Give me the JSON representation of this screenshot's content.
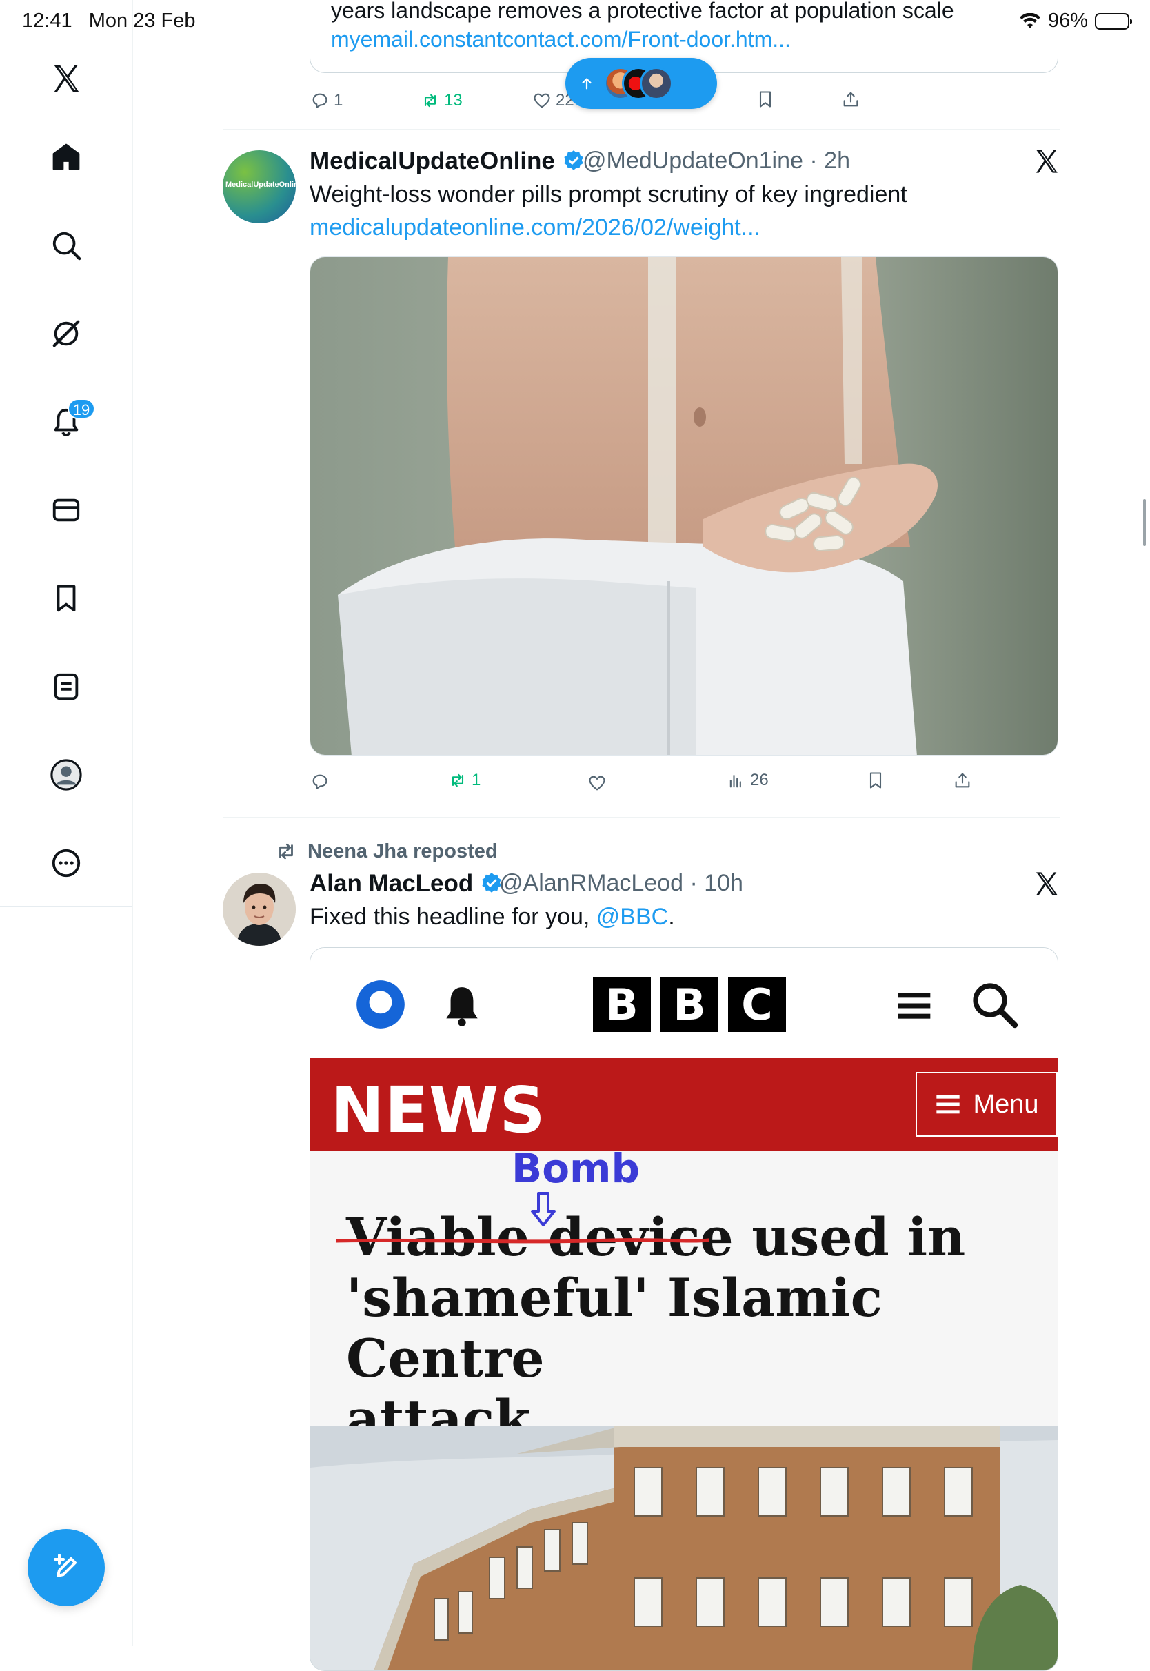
{
  "status_bar": {
    "time": "12:41",
    "date": "Mon 23 Feb",
    "battery": "96%",
    "wifi_icon": "wifi-icon"
  },
  "sidebar": {
    "items": [
      {
        "name": "x-logo",
        "icon": "x-logo-icon"
      },
      {
        "name": "home",
        "icon": "home-icon"
      },
      {
        "name": "explore",
        "icon": "search-icon"
      },
      {
        "name": "grok",
        "icon": "grok-icon"
      },
      {
        "name": "notifications",
        "icon": "bell-icon",
        "badge": "19"
      },
      {
        "name": "messages",
        "icon": "envelope-icon"
      },
      {
        "name": "bookmarks",
        "icon": "bookmark-icon"
      },
      {
        "name": "lists",
        "icon": "list-icon"
      },
      {
        "name": "profile",
        "icon": "profile-icon"
      },
      {
        "name": "more",
        "icon": "more-icon"
      }
    ],
    "compose_icon": "compose-icon"
  },
  "prev_post": {
    "card_text": "years landscape removes a protective factor at population scale",
    "card_link": "myemail.constantcontact.com/Front-door.htm...",
    "actions": {
      "replies": "1",
      "reposts": "13",
      "likes": "22"
    }
  },
  "new_posts_pill": {
    "icon": "arrow-up-icon"
  },
  "post1": {
    "name": "MedicalUpdateOnline",
    "handle": "@MedUpdateOn1ine",
    "time": "2h",
    "text": "Weight-loss wonder pills prompt scrutiny of key ingredient",
    "link": "medicalupdateonline.com/2026/02/weight...",
    "avatar_text": "MedicalUpdateOnline",
    "actions": {
      "reposts": "1",
      "views": "26"
    }
  },
  "post2": {
    "repost_by": "Neena Jha reposted",
    "name": "Alan MacLeod",
    "handle": "@AlanRMacLeod",
    "time": "10h",
    "text_prefix": "Fixed this headline for you, ",
    "mention": "@BBC",
    "text_suffix": ".",
    "image": {
      "bbc_letters": [
        "B",
        "B",
        "C"
      ],
      "news_label": "NEWS",
      "menu_label": "Menu",
      "annotation": "Bomb",
      "struck_words": "Viable device",
      "headline_rest_line1": " used in",
      "headline_line2": "'shameful' Islamic Centre",
      "headline_line3": "attack"
    }
  },
  "colors": {
    "accent": "#1d9bf0",
    "repost_green": "#00ba7c",
    "bbc_red": "#bb1919",
    "strike_red": "#d62828",
    "annotation_blue": "#3b3bd6"
  }
}
